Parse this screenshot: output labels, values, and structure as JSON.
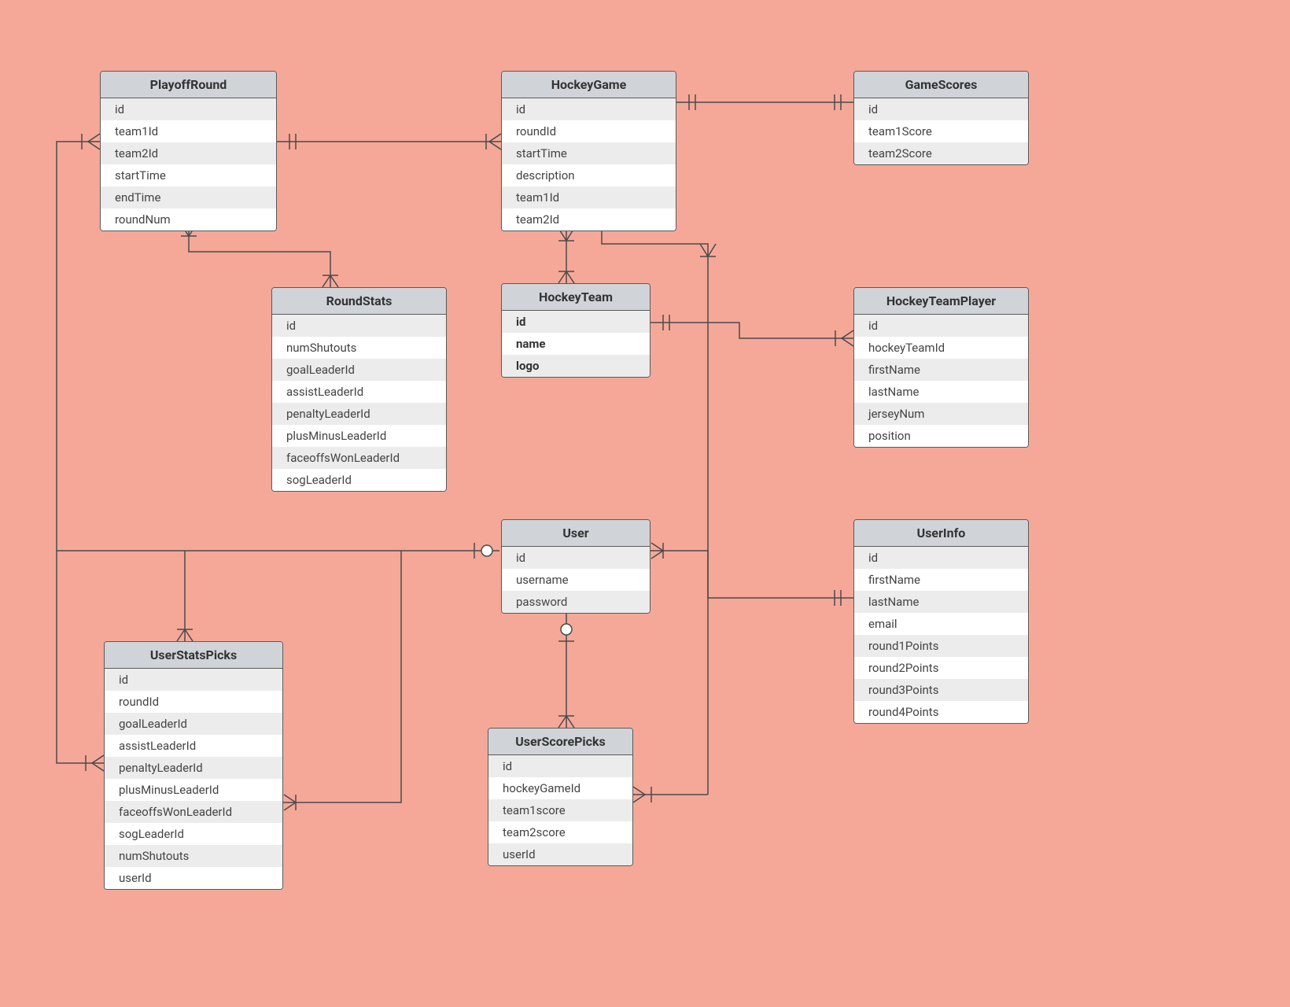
{
  "entities": {
    "playoffRound": {
      "title": "PlayoffRound",
      "fields": [
        "id",
        "team1Id",
        "team2Id",
        "startTime",
        "endTime",
        "roundNum"
      ]
    },
    "hockeyGame": {
      "title": "HockeyGame",
      "fields": [
        "id",
        "roundId",
        "startTime",
        "description",
        "team1Id",
        "team2Id"
      ]
    },
    "gameScores": {
      "title": "GameScores",
      "fields": [
        "id",
        "team1Score",
        "team2Score"
      ]
    },
    "roundStats": {
      "title": "RoundStats",
      "fields": [
        "id",
        "numShutouts",
        "goalLeaderId",
        "assistLeaderId",
        "penaltyLeaderId",
        "plusMinusLeaderId",
        "faceoffsWonLeaderId",
        "sogLeaderId"
      ]
    },
    "hockeyTeam": {
      "title": "HockeyTeam",
      "fields": [
        "id",
        "name",
        "logo"
      ],
      "bold": true
    },
    "hockeyTeamPlayer": {
      "title": "HockeyTeamPlayer",
      "fields": [
        "id",
        "hockeyTeamId",
        "firstName",
        "lastName",
        "jerseyNum",
        "position"
      ]
    },
    "user": {
      "title": "User",
      "fields": [
        "id",
        "username",
        "password"
      ]
    },
    "userInfo": {
      "title": "UserInfo",
      "fields": [
        "id",
        "firstName",
        "lastName",
        "email",
        "round1Points",
        "round2Points",
        "round3Points",
        "round4Points"
      ]
    },
    "userStatsPicks": {
      "title": "UserStatsPicks",
      "fields": [
        "id",
        "roundId",
        "goalLeaderId",
        "assistLeaderId",
        "penaltyLeaderId",
        "plusMinusLeaderId",
        "faceoffsWonLeaderId",
        "sogLeaderId",
        "numShutouts",
        "userId"
      ]
    },
    "userScorePicks": {
      "title": "UserScorePicks",
      "fields": [
        "id",
        "hockeyGameId",
        "team1score",
        "team2score",
        "userId"
      ]
    }
  }
}
